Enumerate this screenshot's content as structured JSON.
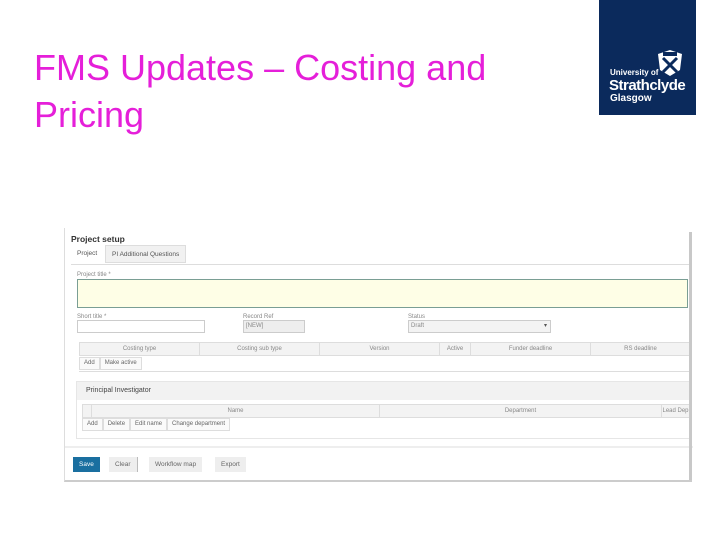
{
  "slide": {
    "title_line1": "FMS Updates – Costing and",
    "title_line2": "Pricing"
  },
  "logo": {
    "line1": "University of",
    "line2": "Strathclyde",
    "line3": "Glasgow"
  },
  "app": {
    "heading": "Project setup",
    "tabs": [
      {
        "label": "Project"
      },
      {
        "label": "PI Additional Questions"
      }
    ],
    "project_title_label": "Project title *",
    "short_title_label": "Short title *",
    "record_ref_label": "Record Ref",
    "record_ref_value": "[NEW]",
    "status_label": "Status",
    "status_value": "Draft",
    "costing_columns": [
      "Costing type",
      "Costing sub type",
      "Version",
      "Active",
      "Funder deadline",
      "RS deadline"
    ],
    "costing_buttons": [
      "Add",
      "Make active"
    ],
    "pi_heading": "Principal Investigator",
    "pi_columns": [
      "Name",
      "Department",
      "Lead Dep"
    ],
    "pi_buttons": [
      "Add",
      "Delete",
      "Edit name",
      "Change department"
    ],
    "footer_buttons": {
      "save": "Save",
      "clear": "Clear",
      "workflow": "Workflow map",
      "export": "Export"
    },
    "colors": {
      "accent": "#1a6fa0",
      "title": "#e51fd9",
      "logo_bg": "#0b2a5c",
      "required_bg": "#fefee6"
    }
  }
}
